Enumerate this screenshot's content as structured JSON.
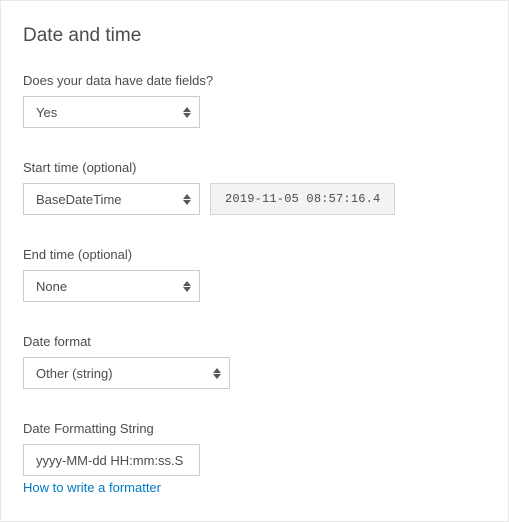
{
  "title": "Date and time",
  "has_date_fields": {
    "label": "Does your data have date fields?",
    "value": "Yes"
  },
  "start_time": {
    "label": "Start time (optional)",
    "value": "BaseDateTime",
    "preview": "2019-11-05 08:57:16.4"
  },
  "end_time": {
    "label": "End time (optional)",
    "value": "None"
  },
  "date_format": {
    "label": "Date format",
    "value": "Other (string)"
  },
  "format_string": {
    "label": "Date Formatting String",
    "value": "yyyy-MM-dd HH:mm:ss.S",
    "help_link": "How to write a formatter"
  }
}
